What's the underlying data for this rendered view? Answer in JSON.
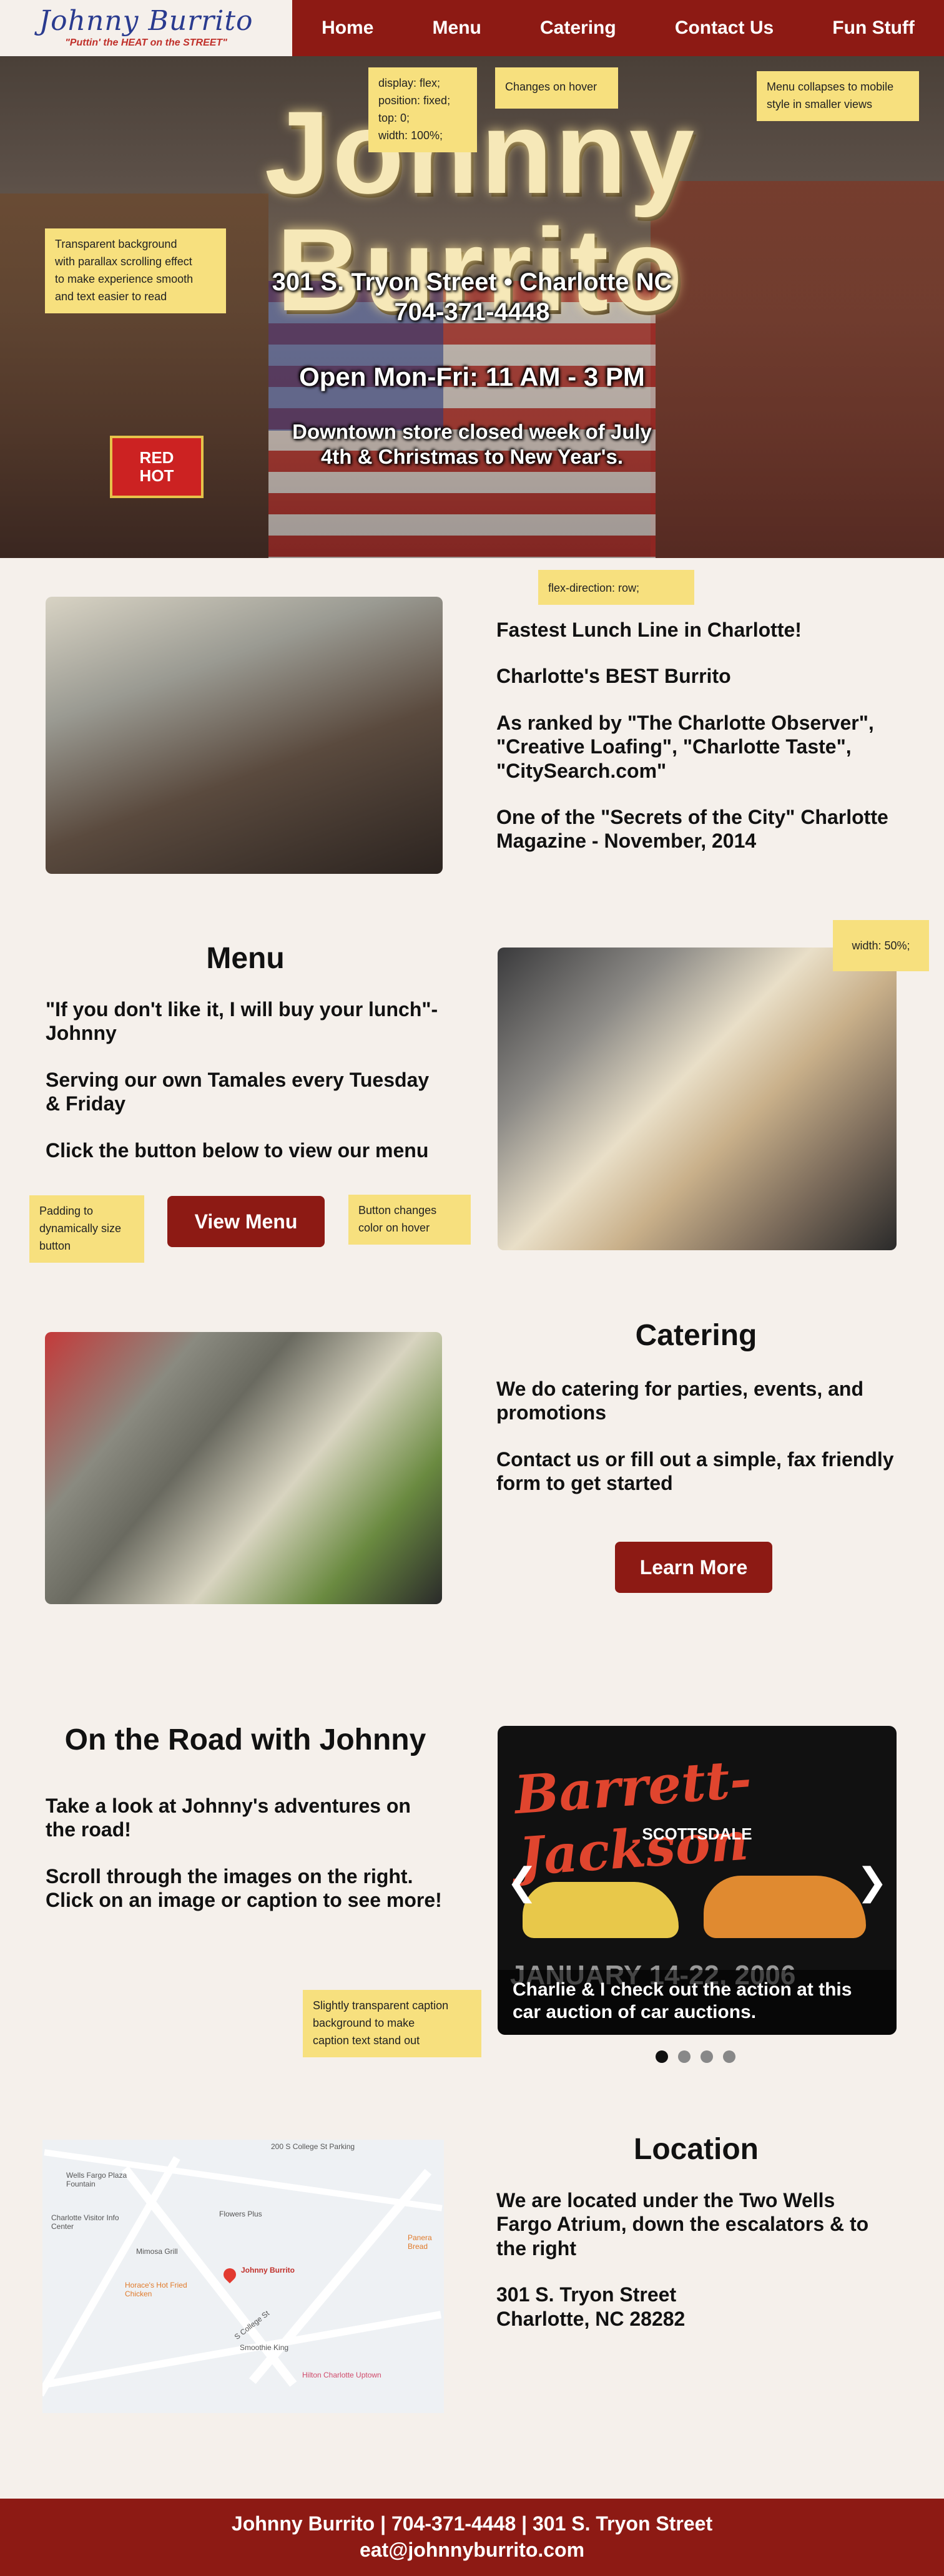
{
  "nav": {
    "logo_title": "Johnny Burrito",
    "logo_tagline": "\"Puttin' the HEAT on the STREET\"",
    "links": [
      "Home",
      "Menu",
      "Catering",
      "Contact Us",
      "Fun Stuff"
    ]
  },
  "hero": {
    "big_sign": "Johnny Burrito",
    "address": "301 S. Tryon Street  • Charlotte NC",
    "phone": "704-371-4448",
    "hours": "Open Mon-Fri: 11 AM - 3 PM",
    "closure_line1": "Downtown store closed week of July",
    "closure_line2": "4th & Christmas to New Year's.",
    "sign_red": "RED",
    "sign_hot": "HOT"
  },
  "notes": {
    "fixed": [
      "display: flex;",
      "position: fixed;",
      "top: 0;",
      "width: 100%;"
    ],
    "hover": "Changes on hover",
    "collapse": [
      "Menu collapses to mobile",
      "style in smaller views"
    ],
    "parallax": [
      "Transparent background",
      "with parallax scrolling effect",
      "to make experience smooth",
      "and  text easier to read"
    ],
    "flex_row": "flex-direction: row;",
    "width50": "width: 50%;",
    "padding": [
      "Padding to",
      "dynamically size",
      "button"
    ],
    "btn_hover": [
      "Button changes",
      "color on hover"
    ],
    "caption_bg": [
      "Slightly transparent caption",
      "background to make",
      "caption text stand out"
    ]
  },
  "about": {
    "lines": [
      "Fastest Lunch Line in Charlotte!",
      "Charlotte's BEST Burrito",
      "As ranked by \"The Charlotte Observer\", \"Creative Loafing\", \"Charlotte Taste\", \"CitySearch.com\"",
      "One of the \"Secrets of the City\" Charlotte Magazine - November, 2014"
    ]
  },
  "menu": {
    "title": "Menu",
    "lines": [
      "\"If you don't like it, I will buy your lunch\"- Johnny",
      "Serving our own Tamales every Tuesday & Friday",
      "Click the button below to view our menu"
    ],
    "button": "View Menu"
  },
  "catering": {
    "title": "Catering",
    "lines": [
      "We do catering for parties, events, and promotions",
      "Contact us or fill out a simple, fax friendly form to get started"
    ],
    "button": "Learn More"
  },
  "road": {
    "title": "On the Road with Johnny",
    "lines": [
      "Take a look at Johnny's adventures on the road!",
      "Scroll through the images on the right. Click on an image or caption to see more!"
    ],
    "slide_title": "Barrett-Jackson",
    "slide_sub": "SCOTTSDALE",
    "slide_date": "JANUARY 14-22, 2006",
    "caption": "Charlie & I check out the action at this car auction of car auctions.",
    "slide_count": 4,
    "active_slide": 1
  },
  "location": {
    "title": "Location",
    "lines": [
      "We are located under the Two Wells Fargo Atrium, down the escalators & to the right",
      "301 S. Tryon Street",
      "Charlotte, NC 28282"
    ],
    "map_labels": {
      "wells": "Wells Fargo Plaza Fountain",
      "visitor": "Charlotte Visitor Info Center",
      "flowers": "Flowers Plus",
      "mimosa": "Mimosa Grill",
      "horaces": "Horace's Hot Fried Chicken",
      "johnny": "Johnny Burrito",
      "smoothie": "Smoothie King",
      "hilton": "Hilton Charlotte Uptown",
      "panera": "Panera Bread",
      "college": "S College St",
      "parking": "200 S College St Parking"
    }
  },
  "footer": {
    "line1": "Johnny Burrito | 704-371-4448 | 301 S. Tryon Street",
    "line2": "eat@johnnyburrito.com"
  }
}
